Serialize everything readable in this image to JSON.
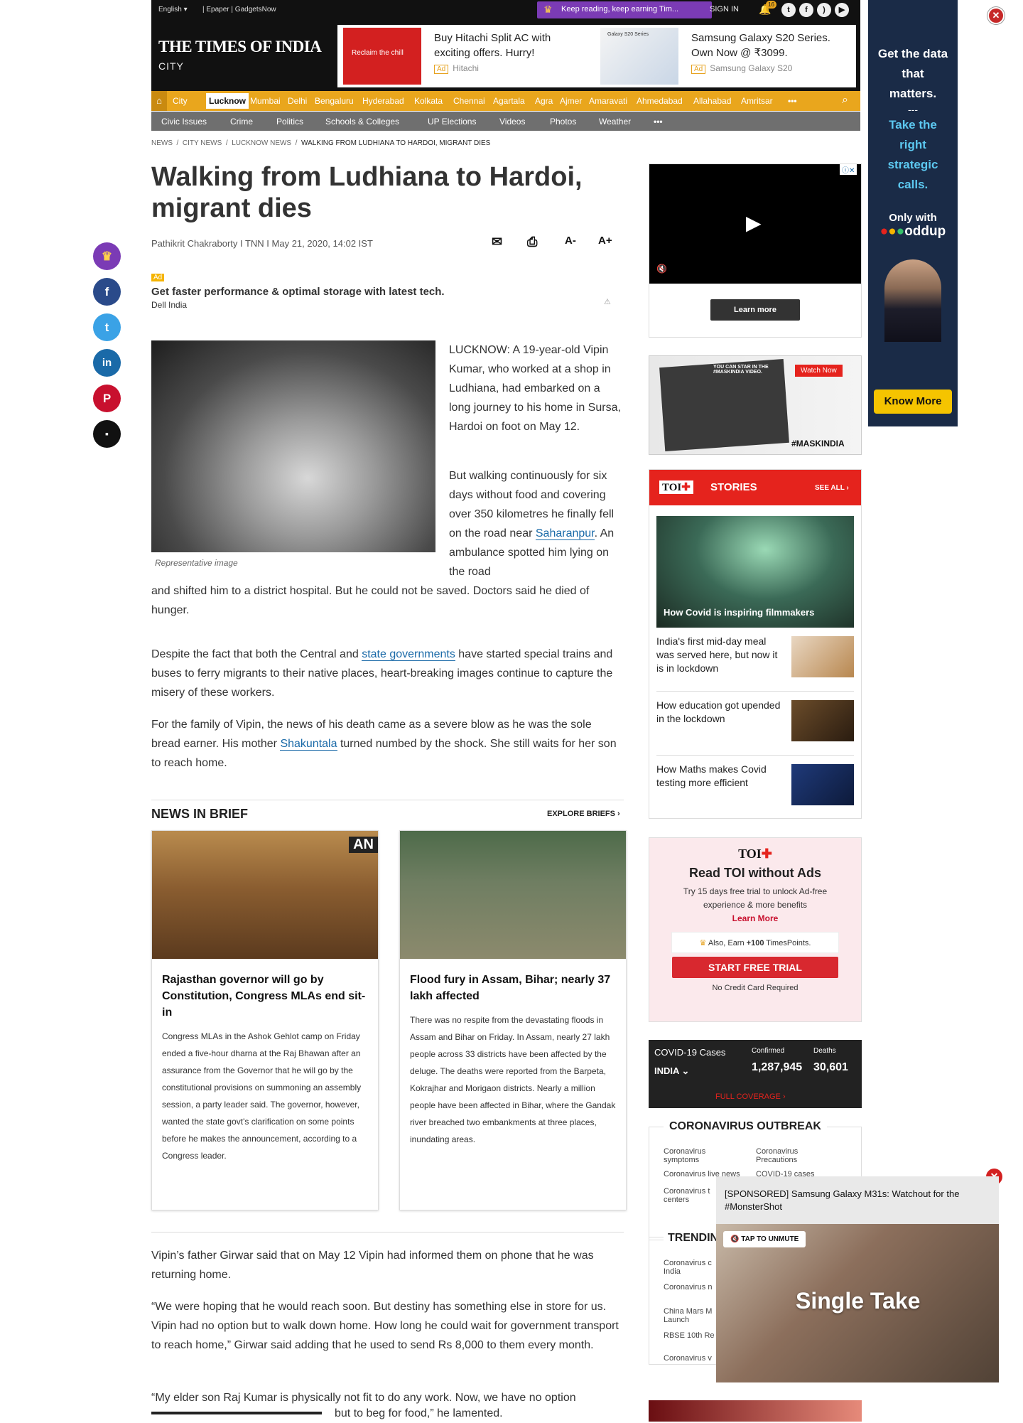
{
  "topbar": {
    "lang": "English",
    "links": [
      "Epaper",
      "GadgetsNow"
    ],
    "promo": "Keep reading, keep earning Tim...",
    "signin": "SIGN IN",
    "notif_count": "16",
    "social": [
      "t",
      "f",
      "rss",
      "yt"
    ]
  },
  "masthead": {
    "logo": "THE TIMES OF INDIA",
    "section": "CITY"
  },
  "top_ads": [
    {
      "title": "Buy Hitachi Split AC with exciting offers. Hurry!",
      "badge": "Ad",
      "source": "Hitachi",
      "img_text": "Reclaim the chill"
    },
    {
      "title": "Samsung Galaxy S20 Series. Own Now @ ₹3099.",
      "badge": "Ad",
      "source": "Samsung Galaxy S20",
      "img_text": "Galaxy S20 Series"
    }
  ],
  "nav": {
    "city": "City",
    "items": [
      "Lucknow",
      "Mumbai",
      "Delhi",
      "Bengaluru",
      "Hyderabad",
      "Kolkata",
      "Chennai",
      "Agartala",
      "Agra",
      "Ajmer",
      "Amaravati",
      "Ahmedabad",
      "Allahabad",
      "Amritsar"
    ],
    "more": "•••"
  },
  "subnav": {
    "items": [
      "Civic Issues",
      "Crime",
      "Politics",
      "Schools & Colleges",
      "UP Elections",
      "Videos",
      "Photos",
      "Weather"
    ],
    "more": "•••"
  },
  "breadcrumb": [
    "NEWS",
    "CITY NEWS",
    "LUCKNOW NEWS",
    "WALKING FROM LUDHIANA TO HARDOI, MIGRANT DIES"
  ],
  "article": {
    "title": "Walking from Ludhiana to Hardoi, migrant dies",
    "byline": "Pathikrit Chakraborty I TNN I May 21, 2020, 14:02 IST",
    "tools": {
      "font_minus": "A-",
      "font_plus": "A+"
    },
    "inline_ad": {
      "badge": "Ad",
      "headline": "Get faster performance & optimal storage with latest tech.",
      "source": "Dell India"
    },
    "image_caption": "Representative image",
    "p1": "LUCKNOW: A 19-year-old Vipin Kumar, who worked at a shop in Ludhiana, had embarked on a long journey to his home in Sursa, Hardoi on foot on May 12.",
    "p2a": "But walking continuously for six days without food and covering over 350 kilometres he finally fell on the road near",
    "p2_link": "Saharanpur",
    "p2b": ". An ambulance spotted him lying on the road",
    "p2c": "and shifted him to a district hospital. But he could not be saved. Doctors said he died of hunger.",
    "p3a": "Despite the fact that both the Central and",
    "p3_link": "state governments",
    "p3b": "have started special trains and buses to ferry migrants to their native places, heart-breaking images continue to capture the misery of these workers.",
    "p4a": "For the family of Vipin, the news of his death came as a severe blow as he was the sole bread earner. His mother",
    "p4_link": "Shakuntala",
    "p4b": "turned numbed by the shock. She still waits for her son to reach home.",
    "p5": "Vipin’s father Girwar said that on May 12 Vipin had informed them on phone that he was returning home.",
    "p6": "“We were hoping that he would reach soon. But destiny has something else in store for us. Vipin had no option but to walk down home. How long he could wait for government transport to reach home,” Girwar said adding that he used to send Rs 8,000 to them every month.",
    "p7a": "“My elder son Raj Kumar is physically not fit to do any work. Now, we have no option",
    "p7b": "but to beg for food,” he lamented."
  },
  "brief": {
    "heading": "NEWS IN BRIEF",
    "explore": "EXPLORE BRIEFS",
    "cards": [
      {
        "title": "Rajasthan governor will go by Constitution, Congress MLAs end sit-in",
        "body": "Congress MLAs in the Ashok Gehlot camp on Friday ended a five-hour dharna at the Raj Bhawan after an assurance from the Governor that he will go by the constitutional provisions on summoning an assembly session, a party leader said. The governor, however, wanted the state govt's clarification on some points before he makes the announcement, according to a Congress leader.",
        "img_tag": "AN"
      },
      {
        "title": "Flood fury in Assam, Bihar; nearly 37 lakh affected",
        "body": "There was no respite from the devastating floods in Assam and Bihar on Friday. In Assam, nearly 27 lakh people across 33 districts have been affected by the deluge. The deaths were reported from the Barpeta, Kokrajhar and Morigaon districts. Nearly a million people have been affected in Bihar, where the Gandak river breached two embankments at three places, inundating areas."
      }
    ]
  },
  "sidebar": {
    "video_learn_more": "Learn more",
    "mask": {
      "text": "YOU CAN STAR IN THE #MASKINDIA VIDEO.",
      "watch": "Watch Now",
      "tag": "#MASKINDIA"
    },
    "stories": {
      "logo": "TOI",
      "label": "STORIES",
      "see_all": "SEE ALL",
      "featured": "How Covid is inspiring filmmakers",
      "items": [
        "India's first mid-day meal was served here, but now it is in lockdown",
        "How education got upended in the lockdown",
        "How Maths makes Covid testing more efficient"
      ]
    },
    "toi_plus": {
      "logo": "TOI",
      "title": "Read TOI without Ads",
      "desc": "Try 15 days free trial to unlock Ad-free experience & more benefits",
      "learn": "Learn More",
      "earn_a": "Also, Earn",
      "earn_b": "+100",
      "earn_c": "TimesPoints.",
      "cta": "START FREE TRIAL",
      "note": "No Credit Card Required"
    },
    "covid": {
      "label": "COVID-19 Cases",
      "country": "INDIA",
      "confirmed_label": "Confirmed",
      "confirmed": "1,287,945",
      "deaths_label": "Deaths",
      "deaths": "30,601",
      "coverage": "FULL COVERAGE"
    },
    "outbreak": {
      "title": "CORONAVIRUS OUTBREAK",
      "links": [
        "Coronavirus symptoms",
        "Coronavirus Precautions",
        "Coronavirus live news",
        "COVID-19 cases",
        "Coronavirus t centers"
      ]
    },
    "trending": {
      "title": "TRENDIN",
      "links": [
        "Coronavirus c India",
        "Coronavirus n",
        "China Mars M Launch",
        "RBSE 10th Re",
        "Coronavirus v"
      ]
    }
  },
  "skyscraper": {
    "l1": "Get the data that matters.",
    "sep": "---",
    "l2": "Take the right strategic calls.",
    "only": "Only with",
    "brand": "oddup",
    "cta": "Know More"
  },
  "floating": {
    "title": "[SPONSORED] Samsung Galaxy M31s: Watchout for the #MonsterShot",
    "unmute": "TAP TO UNMUTE",
    "overlay": "Single Take"
  }
}
